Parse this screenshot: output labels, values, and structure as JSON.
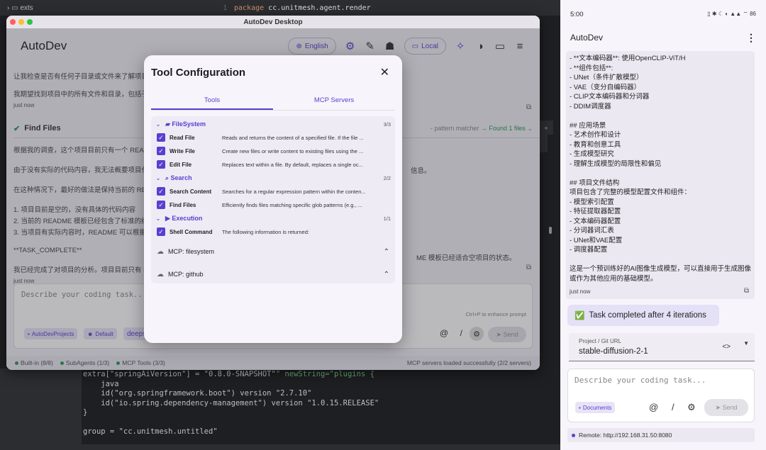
{
  "ide": {
    "tree_item": "exts",
    "line_no": "1",
    "code_keyword": "package",
    "code_rest": " cc.unitmesh.agent.render",
    "bottom_code": [
      {
        "a": "extra[\"springAiVersion\"] = \"0.8.0-SNAPSHOT\"",
        "b": "\" newString=\"plugins {"
      },
      {
        "a": "    java",
        "b": ""
      },
      {
        "a": "    id(\"org.springframework.boot\") version \"2.7.10\"",
        "b": ""
      },
      {
        "a": "    id(\"io.spring.dependency-management\") version \"1.0.15.RELEASE\"",
        "b": ""
      },
      {
        "a": "}",
        "b": ""
      },
      {
        "a": "",
        "b": ""
      },
      {
        "a": "group = \"cc.unitmesh.untitled\"",
        "b": ""
      }
    ]
  },
  "window": {
    "title": "AutoDev Desktop",
    "app_title": "AutoDev",
    "language": "English",
    "mode": "Local"
  },
  "chat": {
    "msg1_line1": "让我检查是否有任何子目录或文件来了解项目的",
    "msg1_line2": "我期望找到项目中的所有文件和目录，包括子目",
    "msg1_time": "just now",
    "tool_name": "Find Files",
    "tool_meta": "- pattern matcher",
    "tool_result": "→ Found 1 files",
    "lines": [
      "根据我的调查，这个项目目前只有一个 README",
      "由于没有实际的代码内容，我无法概要项目代码",
      "在这种情况下，最好的做法是保持当前的 READ",
      "1. 项目目前是空的，没有具体的代码内容",
      "2. 当前的 README 模板已经包含了标准的结构",
      "3. 当项目有实际内容时，README 可以根据具"
    ],
    "right_frag1": "信息。",
    "task_complete": "**TASK_COMPLETE**",
    "final_line": "我已经完成了对项目的分析。项目目前只有 RE",
    "final_right": "ME 模板已经适合空项目的状态。",
    "msg2_time": "just now"
  },
  "input": {
    "placeholder": "Describe your coding task...",
    "hint": "Ctrl+P to enhance prompt",
    "chip_project": "AutoDevProjects",
    "chip_default": "Default",
    "chip_model": "deepse",
    "send": "Send"
  },
  "statusbar": {
    "builtin": "Built-in (8/8)",
    "subagents": "SubAgents (1/3)",
    "mcp_tools": "MCP Tools (3/3)",
    "right": "MCP servers loaded successfully (2/2 servers)"
  },
  "modal": {
    "title": "Tool Configuration",
    "tabs": [
      "Tools",
      "MCP Servers"
    ],
    "categories": [
      {
        "name": "FileSystem",
        "count": "3/3"
      },
      {
        "name": "Search",
        "count": "2/2"
      },
      {
        "name": "Execution",
        "count": "1/1"
      }
    ],
    "tools": [
      {
        "name": "Read File",
        "desc": "Reads and returns the content of a specified file. If the file ..."
      },
      {
        "name": "Write File",
        "desc": "Create new files or write content to existing files using the ..."
      },
      {
        "name": "Edit File",
        "desc": "Replaces text within a file. By default, replaces a single oc..."
      },
      {
        "name": "Search Content",
        "desc": "Searches for a regular expression pattern within the conten..."
      },
      {
        "name": "Find Files",
        "desc": "Efficiently finds files matching specific glob patterns (e.g., ..."
      },
      {
        "name": "Shell Command",
        "desc": "The following information is returned:"
      }
    ],
    "mcp_servers": [
      "MCP: filesystem",
      "MCP: github"
    ]
  },
  "phone": {
    "time": "5:00",
    "status_right": "▯ ✱ ☾ ◐ ▲▲ ⌔ 86",
    "app_title": "AutoDev",
    "lines": [
      "- **文本编码器**: 使用OpenCLIP-ViT/H",
      "- **组件包括**:",
      "  - UNet（条件扩散模型）",
      "  - VAE（变分自编码器）",
      "  - CLIP文本编码器和分词器",
      "  - DDIM调度器",
      "",
      "## 应用场景",
      "- 艺术创作和设计",
      "- 教育和创意工具",
      "- 生成模型研究",
      "- 理解生成模型的局限性和偏见",
      "",
      "## 项目文件结构",
      "项目包含了完整的模型配置文件和组件：",
      "- 模型索引配置",
      "- 特征提取器配置",
      "- 文本编码器配置",
      "- 分词器词汇表",
      "- UNet和VAE配置",
      "- 调度器配置",
      "",
      "这是一个预训练好的AI图像生成模型，可以直接用于生成图像",
      "或作为其他应用的基础模型。"
    ],
    "timestamp": "just now",
    "task_done": "Task completed after 4 iterations",
    "project_label": "Project / Git URL",
    "project_value": "stable-diffusion-2-1",
    "placeholder": "Describe your coding task...",
    "chip": "Documents",
    "send": "Send",
    "remote": "Remote: http://192.168.31.50:8080"
  },
  "colors": {
    "accent": "#5a3fcf",
    "success": "#2e9a4e"
  }
}
